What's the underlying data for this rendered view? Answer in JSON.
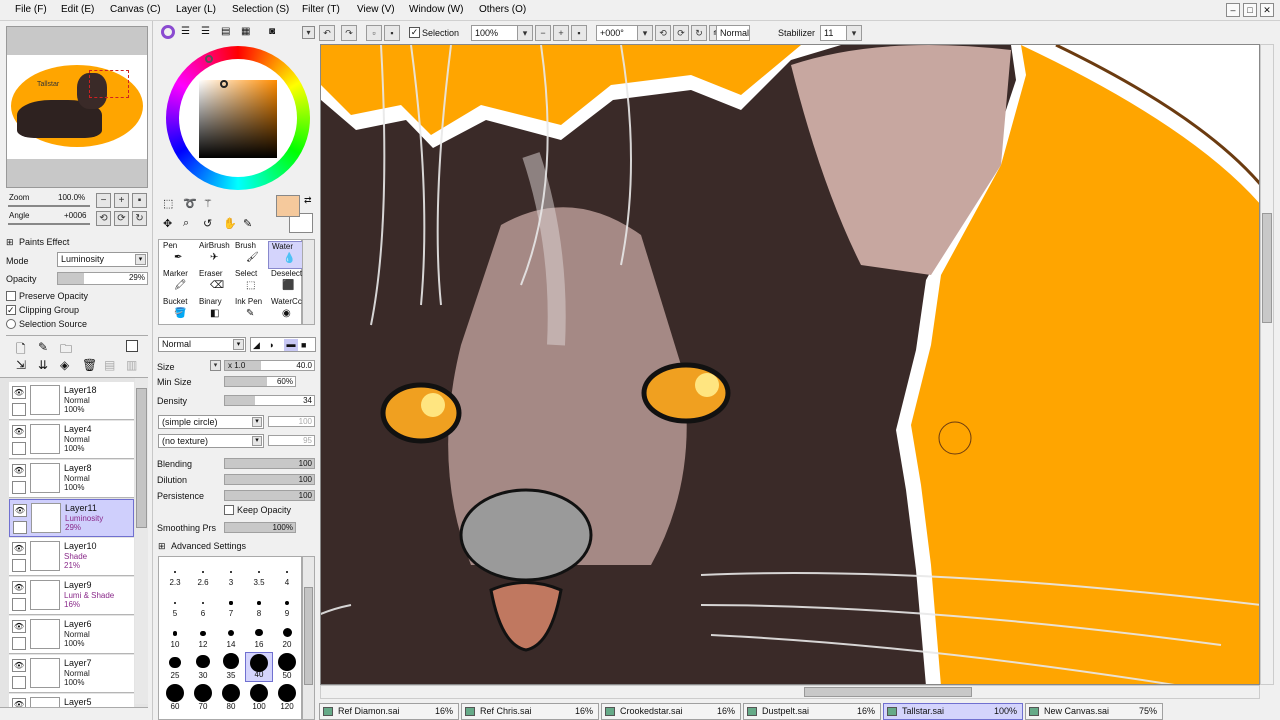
{
  "menu": [
    "File (F)",
    "Edit (E)",
    "Canvas (C)",
    "Layer (L)",
    "Selection (S)",
    "Filter (T)",
    "View (V)",
    "Window (W)",
    "Others (O)"
  ],
  "toolbar": {
    "selection_label": "Selection",
    "zoom": "100%",
    "angle": "+000°",
    "blend": "Normal",
    "stabilizer_label": "Stabilizer",
    "stabilizer_value": "11"
  },
  "navigator": {
    "zoom_label": "Zoom",
    "zoom_value": "100.0%",
    "angle_label": "Angle",
    "angle_value": "+0006",
    "thumb_text": "Tallstar"
  },
  "paint_effect": {
    "title": "Paints Effect",
    "mode_label": "Mode",
    "mode_value": "Luminosity",
    "opacity_label": "Opacity",
    "opacity_value": "29%",
    "opacity_fraction": 0.29,
    "preserve_opacity": "Preserve Opacity",
    "clipping_group": "Clipping Group",
    "selection_source": "Selection Source"
  },
  "layers": [
    {
      "name": "Layer18",
      "mode": "Normal",
      "opacity": "100%",
      "purple": false,
      "selected": false
    },
    {
      "name": "Layer4",
      "mode": "Normal",
      "opacity": "100%",
      "purple": false,
      "selected": false
    },
    {
      "name": "Layer8",
      "mode": "Normal",
      "opacity": "100%",
      "purple": false,
      "selected": false
    },
    {
      "name": "Layer11",
      "mode": "Luminosity",
      "opacity": "29%",
      "purple": true,
      "selected": true
    },
    {
      "name": "Layer10",
      "mode": "Shade",
      "opacity": "21%",
      "purple": true,
      "selected": false
    },
    {
      "name": "Layer9",
      "mode": "Lumi & Shade",
      "opacity": "16%",
      "purple": true,
      "selected": false
    },
    {
      "name": "Layer6",
      "mode": "Normal",
      "opacity": "100%",
      "purple": false,
      "selected": false
    },
    {
      "name": "Layer7",
      "mode": "Normal",
      "opacity": "100%",
      "purple": false,
      "selected": false
    },
    {
      "name": "Layer5",
      "mode": "",
      "opacity": "",
      "purple": false,
      "selected": false
    }
  ],
  "tools": [
    {
      "label": "Pen"
    },
    {
      "label": "AirBrush"
    },
    {
      "label": "Brush"
    },
    {
      "label": "Water"
    },
    {
      "label": "Marker"
    },
    {
      "label": "Eraser"
    },
    {
      "label": "Select"
    },
    {
      "label": "Deselect"
    },
    {
      "label": "Bucket"
    },
    {
      "label": "Binary"
    },
    {
      "label": "Ink Pen"
    },
    {
      "label": "WaterCc"
    }
  ],
  "brush": {
    "blend": "Normal",
    "size_label": "Size",
    "size_mult": "x 1.0",
    "size_value": "40.0",
    "min_size_label": "Min Size",
    "min_size_value": "60%",
    "density_label": "Density",
    "density_value": "34",
    "shape": "(simple circle)",
    "shape_value": "100",
    "texture": "(no texture)",
    "texture_value": "95",
    "blending_label": "Blending",
    "blending_value": "100",
    "dilution_label": "Dilution",
    "dilution_value": "100",
    "persistence_label": "Persistence",
    "persistence_value": "100",
    "keep_opacity": "Keep Opacity",
    "smoothing_label": "Smoothing Prs",
    "smoothing_value": "100%",
    "advanced": "Advanced Settings"
  },
  "brush_sizes": [
    "2.3",
    "2.6",
    "3",
    "3.5",
    "4",
    "5",
    "6",
    "7",
    "8",
    "9",
    "10",
    "12",
    "14",
    "16",
    "20",
    "25",
    "30",
    "35",
    "40",
    "50",
    "60",
    "70",
    "80",
    "100",
    "120"
  ],
  "tabs": [
    {
      "name": "Ref Diamon.sai",
      "pct": "16%",
      "active": false
    },
    {
      "name": "Ref Chris.sai",
      "pct": "16%",
      "active": false
    },
    {
      "name": "Crookedstar.sai",
      "pct": "16%",
      "active": false
    },
    {
      "name": "Dustpelt.sai",
      "pct": "16%",
      "active": false
    },
    {
      "name": "Tallstar.sai",
      "pct": "100%",
      "active": true
    },
    {
      "name": "New Canvas.sai",
      "pct": "75%",
      "active": false
    }
  ],
  "colors": {
    "accent": "#d4d4fc",
    "canvas_bg": "#ffa500",
    "fur": "#3a2a28",
    "eye": "#f0a020",
    "primary_swatch": "#f5c99c"
  }
}
